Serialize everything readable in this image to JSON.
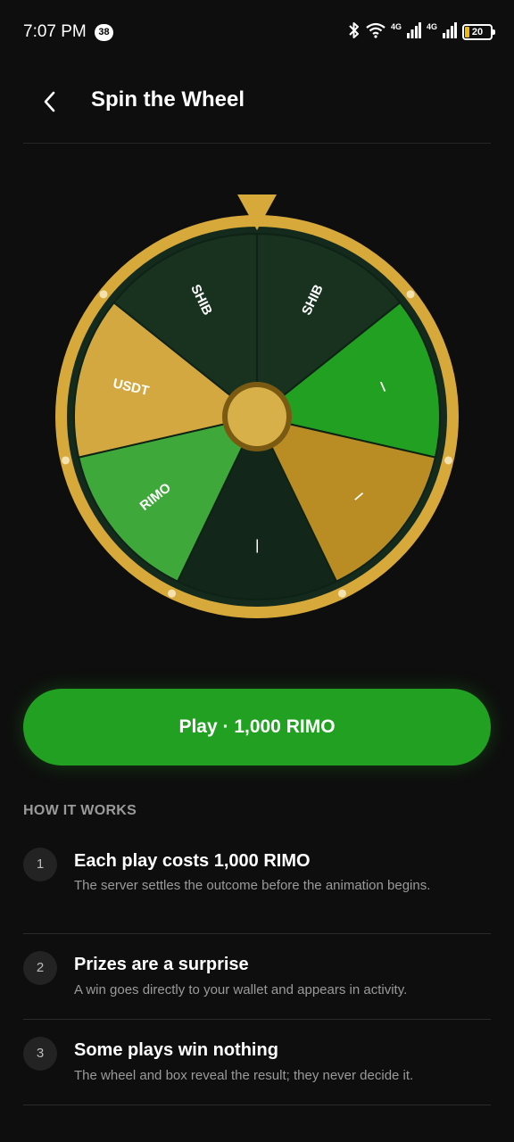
{
  "status_bar": {
    "time": "7:07 PM",
    "notification_count": "38",
    "network_1": "4G",
    "network_2": "4G",
    "battery": "20"
  },
  "header": {
    "back_icon": "chevron-left-icon",
    "title": "Spin the Wheel"
  },
  "wheel": {
    "pointer_icon": "triangle-pointer-icon",
    "colors": {
      "rim": "#d7a93a",
      "inner_ring": "#142a1c",
      "dark_segment": "#19321f",
      "darker_segment": "#122619",
      "bright_green": "#22a022",
      "light_green": "#3ea83a",
      "gold": "#d4a840",
      "dark_gold": "#b98d24",
      "hub": "#d7b04a"
    },
    "segments": [
      {
        "label": "SHIB",
        "color": "#19321f"
      },
      {
        "label": "\\",
        "color": "#22a022"
      },
      {
        "label": "/",
        "color": "#b98d24"
      },
      {
        "label": "—",
        "color": "#122619"
      },
      {
        "label": "RIMO",
        "color": "#3ea83a"
      },
      {
        "label": "USDT",
        "color": "#d4a840"
      },
      {
        "label": "SHIB",
        "color": "#19321f"
      }
    ]
  },
  "play_button": {
    "label": "Play · 1,000 RIMO"
  },
  "how_it_works": {
    "heading": "HOW IT WORKS",
    "steps": [
      {
        "number": "1",
        "title": "Each play costs 1,000 RIMO",
        "description": "The server settles the outcome before the animation begins."
      },
      {
        "number": "2",
        "title": "Prizes are a surprise",
        "description": "A win goes directly to your wallet and appears in activity."
      },
      {
        "number": "3",
        "title": "Some plays win nothing",
        "description": "The wheel and box reveal the result; they never decide it."
      }
    ]
  }
}
